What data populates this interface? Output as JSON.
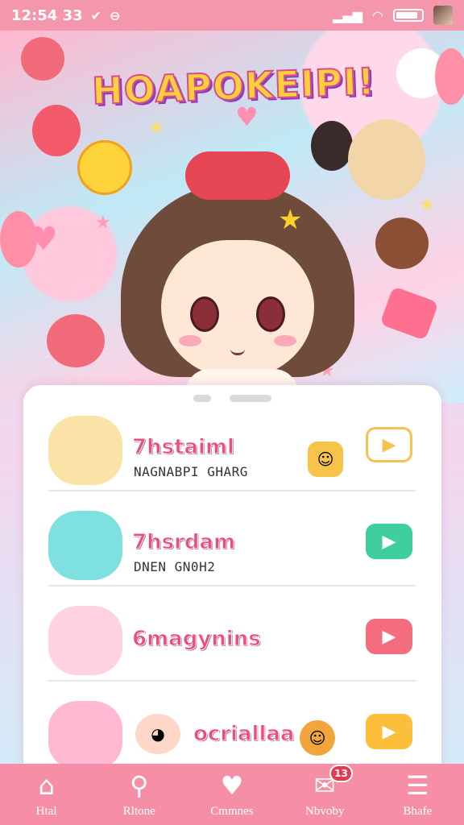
{
  "status_bar": {
    "time": "12:54 33",
    "carrier_icon": "v-icon",
    "message_icon": "message-icon"
  },
  "hero": {
    "title": "HOAPOKEIPI!",
    "title_colors": {
      "fill": "#ffd03b",
      "stroke": "#d84d8c",
      "shadow": "#8a3ebf"
    }
  },
  "list": [
    {
      "title": "7hstaiml",
      "subtitle": "NAGNABPI GHARG",
      "button_style": "outline",
      "button_color": "#f5c24d",
      "avatar_color": "#fbe3a8",
      "sticker_color": "#f8c34b"
    },
    {
      "title": "7hsrdam",
      "subtitle": "DNEN GN0H2",
      "button_style": "filled",
      "button_color": "#3fcf9c",
      "avatar_color": "#7ee1df",
      "sticker_color": ""
    },
    {
      "title": "6magynins",
      "subtitle": "",
      "button_style": "filled",
      "button_color": "#f36d7e",
      "avatar_color": "#ffd1e2",
      "sticker_color": ""
    },
    {
      "title": "ocriallaa",
      "subtitle": "",
      "button_style": "filled",
      "button_color": "#fbbf3c",
      "avatar_color": "#ffb9d3",
      "sticker_color": "#f0a63d"
    }
  ],
  "nav": [
    {
      "label": "Htal",
      "icon": "home-icon",
      "glyph": "⌂"
    },
    {
      "label": "Rltone",
      "icon": "search-icon",
      "glyph": "⚲"
    },
    {
      "label": "Cmmnes",
      "icon": "heart-icon",
      "glyph": "♥"
    },
    {
      "label": "Nbvoby",
      "icon": "inbox-icon",
      "glyph": "✉",
      "badge": "13"
    },
    {
      "label": "Bhafe",
      "icon": "menu-icon",
      "glyph": "☰"
    }
  ],
  "colors": {
    "accent": "#f68ea8",
    "status_bar": "#f497ad",
    "title_pink": "#e94e7f"
  }
}
